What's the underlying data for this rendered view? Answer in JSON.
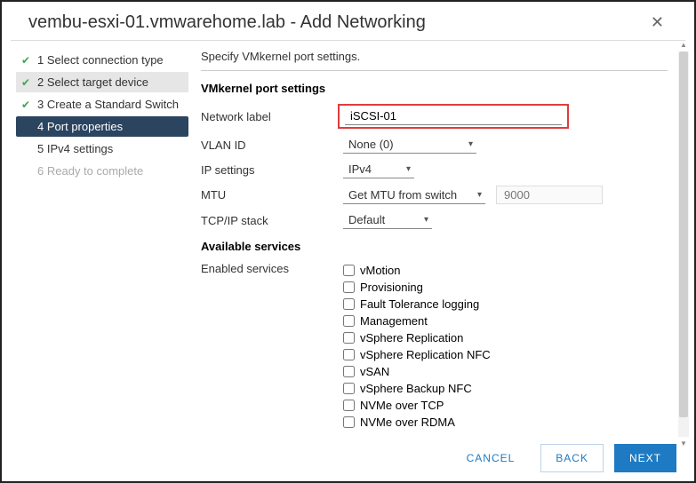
{
  "header": {
    "title": "vembu-esxi-01.vmwarehome.lab - Add Networking",
    "close": "✕"
  },
  "steps": [
    {
      "num": "1",
      "label": "Select connection type",
      "done": true
    },
    {
      "num": "2",
      "label": "Select target device",
      "done": true
    },
    {
      "num": "3",
      "label": "Create a Standard Switch",
      "done": true
    },
    {
      "num": "4",
      "label": "Port properties",
      "done": false,
      "active": true
    },
    {
      "num": "5",
      "label": "IPv4 settings",
      "done": false
    },
    {
      "num": "6",
      "label": "Ready to complete",
      "done": false,
      "disabled": true
    }
  ],
  "main": {
    "description": "Specify VMkernel port settings.",
    "section1": "VMkernel port settings",
    "network_label_label": "Network label",
    "network_label_value": "iSCSI-01",
    "vlan_label": "VLAN ID",
    "vlan_value": "None (0)",
    "ip_label": "IP settings",
    "ip_value": "IPv4",
    "mtu_label": "MTU",
    "mtu_value": "Get MTU from switch",
    "mtu_extra": "9000",
    "stack_label": "TCP/IP stack",
    "stack_value": "Default",
    "section2": "Available services",
    "enabled_label": "Enabled services",
    "services": [
      "vMotion",
      "Provisioning",
      "Fault Tolerance logging",
      "Management",
      "vSphere Replication",
      "vSphere Replication NFC",
      "vSAN",
      "vSphere Backup NFC",
      "NVMe over TCP",
      "NVMe over RDMA"
    ]
  },
  "footer": {
    "cancel": "CANCEL",
    "back": "BACK",
    "next": "NEXT"
  }
}
